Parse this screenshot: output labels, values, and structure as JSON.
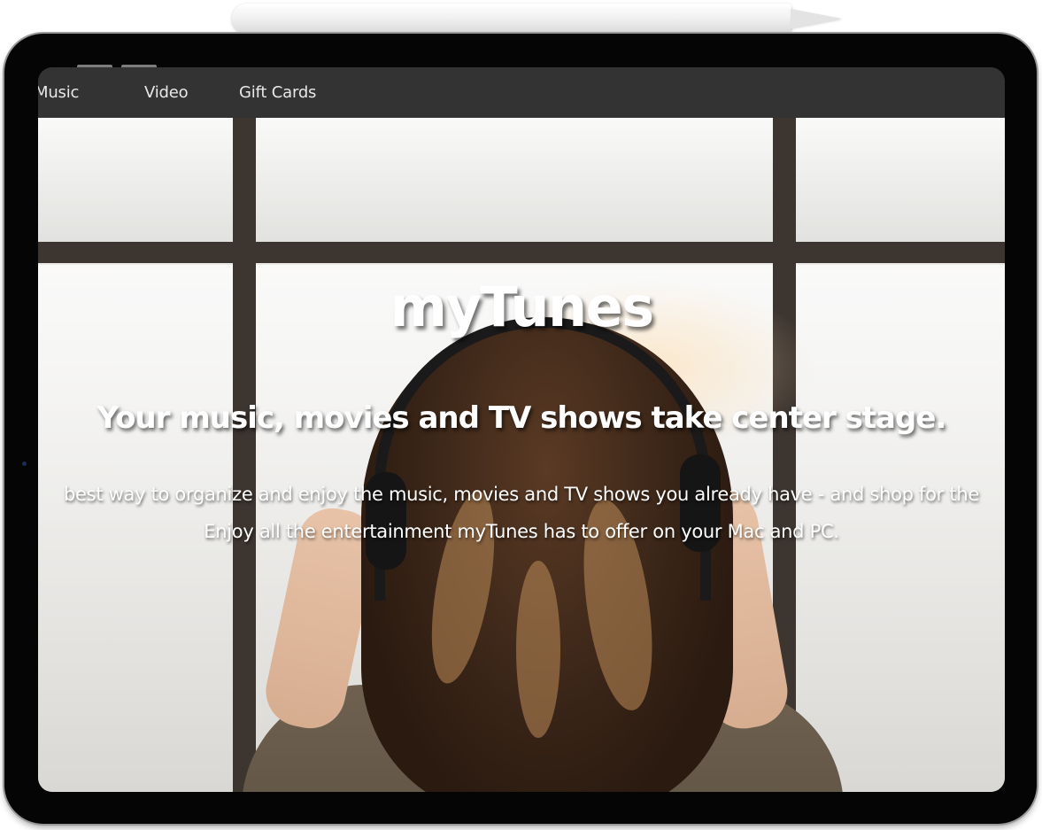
{
  "nav": {
    "items": [
      {
        "label": "Music"
      },
      {
        "label": "Video"
      },
      {
        "label": "Gift Cards"
      }
    ]
  },
  "hero": {
    "title": "myTunes",
    "tagline": "Your music, movies and TV shows take center stage.",
    "description_line1": "best way to organize and enjoy the music, movies and TV shows you already have - and shop for the",
    "description_line2": "Enjoy all the entertainment myTunes has to offer on your Mac and PC.",
    "image": "woman-with-headphones-at-window"
  },
  "colors": {
    "navbar_bg": "#333333",
    "nav_text": "#e8e8e8",
    "hero_text": "#ffffff",
    "device_frame": "#050505"
  }
}
